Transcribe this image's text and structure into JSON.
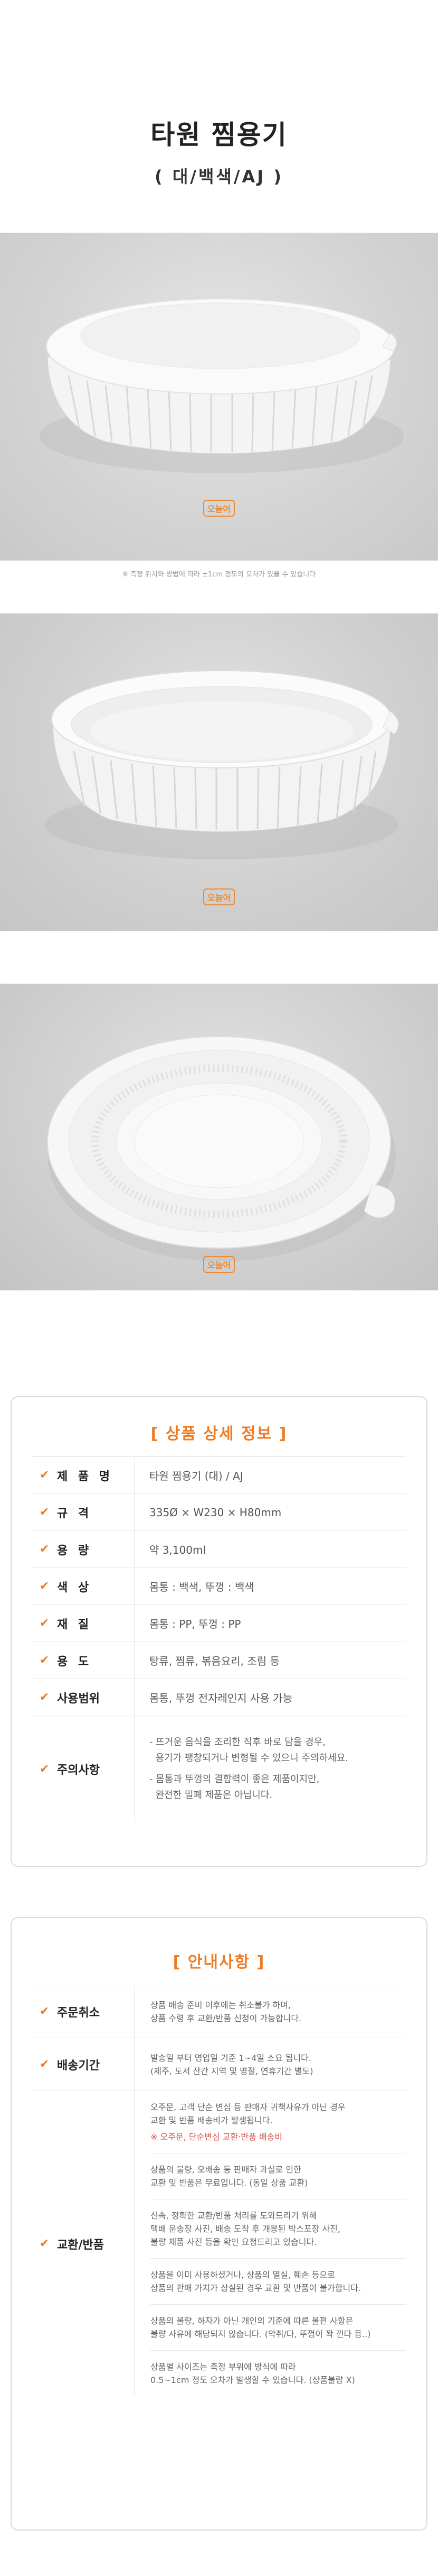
{
  "title": {
    "main": "타원 찜용기",
    "sub": "( 대/백색/AJ )"
  },
  "watermark": "오늘어",
  "photo_note": "※ 측정 위치와 방법에 따라 ±1cm 정도의 오차가 있을 수 있습니다",
  "colors": {
    "accent": "#ee7a22",
    "photo_bg": "#d3d3d3",
    "border": "#d9d9d9",
    "warning": "#d9534f"
  },
  "spec": {
    "heading": "[ 상품 상세 정보 ]",
    "check_icon": "check-icon",
    "rows": [
      {
        "label": "제 품 명",
        "value": "타원 찜용기 (대) / AJ"
      },
      {
        "label": "규 격",
        "value": "335Ø × W230 × H80mm"
      },
      {
        "label": "용 량",
        "value": "약 3,100ml"
      },
      {
        "label": "색 상",
        "value": "몸통 : 백색, 뚜껑 : 백색"
      },
      {
        "label": "재 질",
        "value": "몸통 : PP, 뚜껑 : PP"
      },
      {
        "label": "용 도",
        "value": "탕류, 찜류, 볶음요리, 조림 등"
      },
      {
        "label": "사용범위",
        "value": "몸통, 뚜껑 전자레인지 사용 가능"
      }
    ],
    "caution": {
      "label": "주의사항",
      "lines": [
        "- 뜨거운 음식을 조리한 직후 바로 담을 경우,",
        "  용기가 팽창되거나 변형될 수 있으니 주의하세요.",
        "- 몸통과 뚜껑의 결합력이 좋은 제품이지만,",
        "  완전한 밀폐 제품은 아닙니다."
      ]
    }
  },
  "guide": {
    "heading": "[ 안내사항 ]",
    "cancel": {
      "label": "주문취소",
      "lines": [
        "상품 배송 준비 이후에는 취소불가 하며,",
        "상품 수령 후 교환/반품 신청이 가능합니다."
      ]
    },
    "shipping": {
      "label": "배송기간",
      "lines": [
        "발송일 부터 영업일 기준 1~4일 소요 됩니다.",
        "(제주, 도서 산간 지역 및 명절, 연휴기간 별도)"
      ]
    },
    "returns": {
      "label": "교환/반품",
      "blocks": [
        {
          "lines": [
            "오주문, 고객 단순 변심 등 판매자 귀책사유가 아닌 경우",
            "교환 및 반품 배송비가 발생됩니다."
          ],
          "red": "※ 오주문, 단순변심 교환·반품 배송비"
        },
        {
          "lines": [
            "상품의 불량, 오배송 등 판매자 과실로 인한",
            "교환 및 반품은 무료입니다. (동일 상품 교환)"
          ]
        },
        {
          "lines": [
            "신속, 정확한 교환/반품 처리를 도와드리기 위해",
            "택배 운송장 사진, 배송 도착 후 개봉된 박스포장 사진,",
            "불량 제품 사진 등을 확인 요청드리고 있습니다."
          ]
        },
        {
          "lines": [
            "상품을 이미 사용하셨거나, 상품의 멸실, 훼손 등으로",
            "상품의 판매 가치가 상실된 경우 교환 및 반품이 불가합니다."
          ]
        },
        {
          "lines": [
            "상품의 불량, 하자가 아닌 개인의 기준에 따른 불편 사항은",
            "불량 사유에 해당되지 않습니다. (악취/다, 뚜껑이 꽉 낀다 등..)"
          ]
        },
        {
          "lines": [
            "상품별 사이즈는 측정 부위에 방식에 따라",
            "0.5~1cm 정도 오차가 발생할 수 있습니다. (상품불량 X)"
          ]
        }
      ]
    }
  }
}
